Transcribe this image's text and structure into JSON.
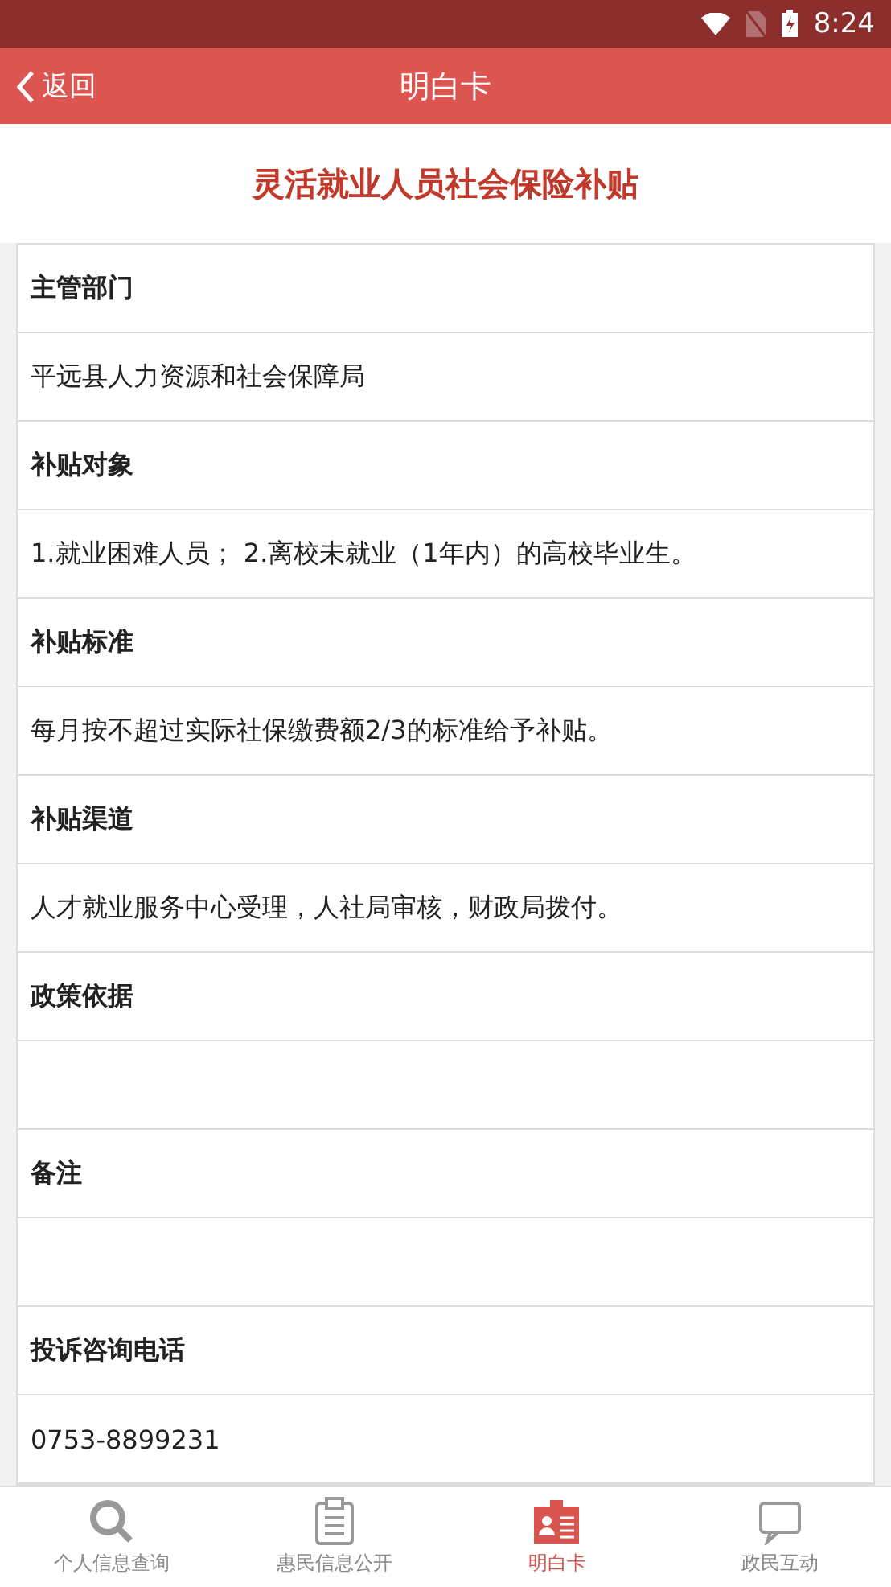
{
  "status_bar": {
    "time": "8:24"
  },
  "header": {
    "back": "返回",
    "title": "明白卡"
  },
  "card_title": "灵活就业人员社会保险补贴",
  "sections": [
    {
      "label": "主管部门",
      "value": "平远县人力资源和社会保障局"
    },
    {
      "label": "补贴对象",
      "value": "1.就业困难人员； 2.离校未就业（1年内）的高校毕业生。"
    },
    {
      "label": "补贴标准",
      "value": "每月按不超过实际社保缴费额2/3的标准给予补贴。"
    },
    {
      "label": "补贴渠道",
      "value": "人才就业服务中心受理，人社局审核，财政局拨付。"
    },
    {
      "label": "政策依据"
    },
    {
      "label": "备注"
    },
    {
      "label": "投诉咨询电话",
      "value": "0753-8899231"
    }
  ],
  "tabs": [
    {
      "kind": "search",
      "label": "个人信息查询",
      "selected": false
    },
    {
      "kind": "clipboard",
      "label": "惠民信息公开",
      "selected": false
    },
    {
      "kind": "card",
      "label": "明白卡",
      "selected": true
    },
    {
      "kind": "chat",
      "label": "政民互动",
      "selected": false
    }
  ]
}
